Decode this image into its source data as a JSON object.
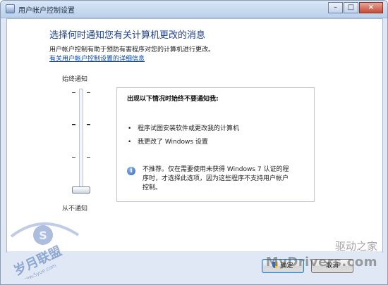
{
  "window": {
    "title": "用户帐户控制设置",
    "controls": {
      "minimize": "–",
      "maximize": "□",
      "close": "×"
    }
  },
  "main": {
    "heading": "选择何时通知您有关计算机更改的消息",
    "description": "用户帐户控制有助于预防有害程序对您的计算机进行更改。",
    "link": "有关用户帐户控制设置的详细信息"
  },
  "slider": {
    "top_label": "始终通知",
    "bottom_label": "从不通知",
    "levels": 4,
    "selected_level": 1
  },
  "info": {
    "title": "出现以下情况时始终不要通知我:",
    "bullets": [
      "程序试图安装软件或更改我的计算机",
      "我更改了 Windows 设置"
    ],
    "note": "不推荐。仅在需要使用未获得 Windows 7 认证的程序时，才选择此选项，因为这些程序不支持用户帐户控制。"
  },
  "buttons": {
    "ok": "确定",
    "cancel": "取消"
  },
  "watermarks": {
    "left": "岁月联盟",
    "left_url": "www.5yue.com",
    "right_brand": "驱动之家",
    "right_site": "MyDrivers.com"
  },
  "colors": {
    "heading": "#1b3d8a",
    "link": "#0645ad",
    "close_button": "#c44a33"
  },
  "icons": {
    "app": "shield-window-icon",
    "note": "info-icon",
    "ok": "uac-shield-icon"
  }
}
